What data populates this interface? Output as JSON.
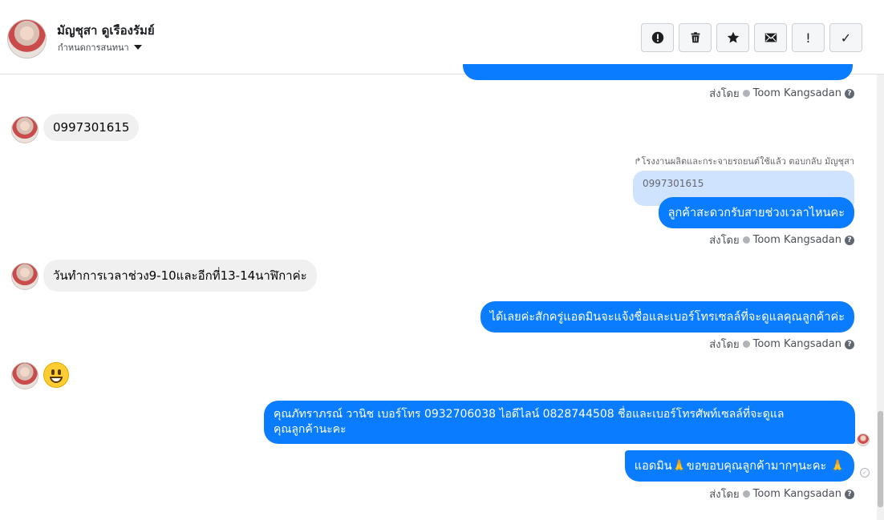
{
  "header": {
    "name": "มัญชุสา ดูเรืองรัมย์",
    "assign_label": "กำหนดการสนทนา",
    "toolbar": [
      {
        "name": "spam-button",
        "icon": "alert-circle-icon"
      },
      {
        "name": "delete-button",
        "icon": "trash-icon"
      },
      {
        "name": "star-button",
        "icon": "star-icon"
      },
      {
        "name": "mark-unread-button",
        "icon": "envelope-icon"
      },
      {
        "name": "important-button",
        "icon": "exclamation-icon",
        "glyph": "!"
      },
      {
        "name": "done-button",
        "icon": "check-icon",
        "glyph": "✓"
      }
    ]
  },
  "sent_by": {
    "prefix": "ส่งโดย",
    "agent": "Toom Kangsadan",
    "help": "?"
  },
  "messages": {
    "in_phone": "0997301615",
    "reply_hint": "โรงงานผลิตและกระจายรถยนต์ใช้แล้ว ตอบกลับ มัญชุสา",
    "quoted_text": "0997301615",
    "out_ask_time": "ลูกค้าสะดวกรับสายช่วงเวลาไหนคะ",
    "in_time": "วันทำการเวลาช่วง9-10และอีกที่13-14นาฬิกาค่ะ",
    "out_confirm": "ได้เลยค่ะสักครู่แอดมินจะแจ้งชื่อและเบอร์โทรเซลล์ที่จะดูแลคุณลูกค้าค่ะ",
    "out_contact_line1": "คุณภัทราภรณ์  วานิช      เบอร์โทร 0932706038  ไอดีไลน์ 0828744508 ชื่อและเบอร์โทรศัพท์เซลล์ที่จะดูแล",
    "out_contact_line2": "คุณลูกค้านะคะ",
    "out_thanks": "แอดมิน🙏ขอขอบคุณลูกค้ามากๆนะคะ 🙏"
  },
  "colors": {
    "outgoing": "#0a7cff",
    "incoming": "#f0f0f0",
    "quoted": "#cfe3ff"
  }
}
